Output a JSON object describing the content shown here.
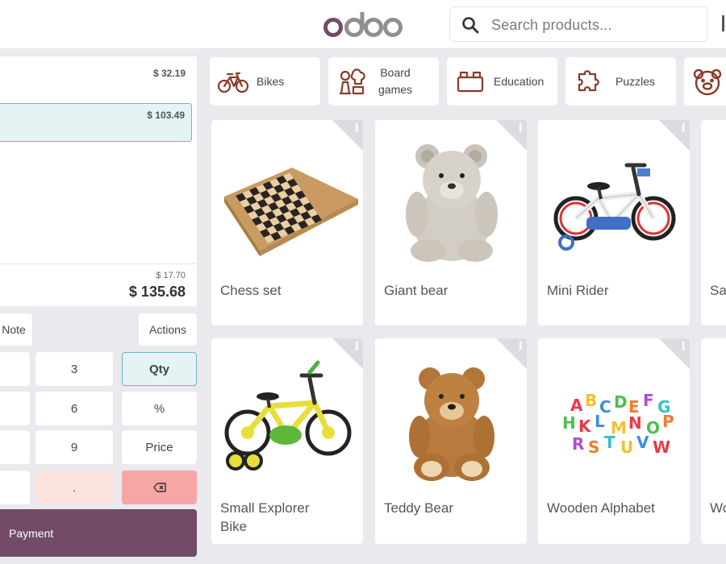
{
  "header": {
    "logo_text": "odoo",
    "search_placeholder": "Search products..."
  },
  "order": {
    "lines": [
      {
        "price": "$ 32.19"
      },
      {
        "price": "$ 103.49",
        "selected": true
      }
    ],
    "tax": "$ 17.70",
    "total": "$ 135.68"
  },
  "controls": {
    "note_label": "Note",
    "actions_label": "Actions"
  },
  "numpad": {
    "keys": [
      "3",
      "Qty",
      "6",
      "%",
      "9",
      "Price",
      "."
    ],
    "active_mode": "Qty"
  },
  "payment_label": "Payment",
  "categories": [
    {
      "label": "Bikes",
      "icon": "bike-icon"
    },
    {
      "label": "Board\ngames",
      "icon": "board-games-icon"
    },
    {
      "label": "Education",
      "icon": "education-icon"
    },
    {
      "label": "Puzzles",
      "icon": "puzzle-icon"
    },
    {
      "label": "",
      "icon": "teddy-icon"
    }
  ],
  "products": [
    {
      "name": "Chess set",
      "image": "chess-board"
    },
    {
      "name": "Giant bear",
      "image": "grey-teddy-bear"
    },
    {
      "name": "Mini Rider",
      "image": "kids-bike-red-white"
    },
    {
      "name": "Sa",
      "image": "partial-product"
    },
    {
      "name": "Small Explorer\nBike",
      "image": "kids-bike-green-yellow"
    },
    {
      "name": "Teddy Bear",
      "image": "brown-teddy-bear"
    },
    {
      "name": "Wooden Alphabet",
      "image": "colorful-letters"
    },
    {
      "name": "Wo",
      "image": "partial-product"
    }
  ],
  "colors": {
    "brand": "#714b67",
    "selected_bg": "#e5f3f4",
    "selected_border": "#6fb6bd",
    "backspace": "#f7a6a6",
    "category_icon": "#8a3a2a"
  }
}
